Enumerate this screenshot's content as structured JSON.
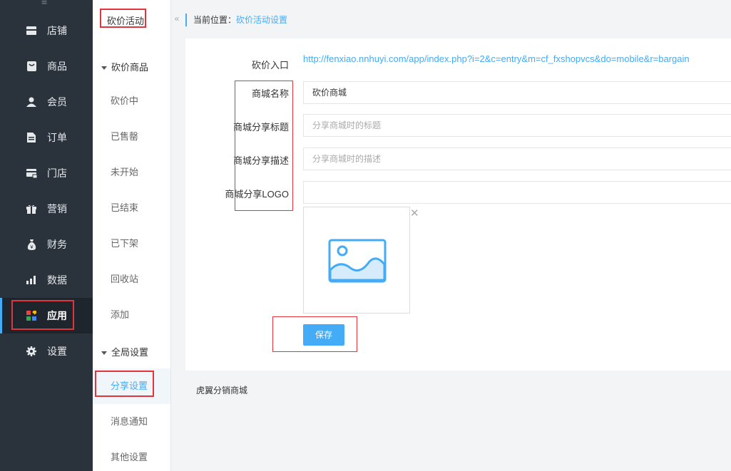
{
  "nav": {
    "items": [
      {
        "label": "店铺",
        "icon": "store-icon"
      },
      {
        "label": "商品",
        "icon": "goods-icon"
      },
      {
        "label": "会员",
        "icon": "member-icon"
      },
      {
        "label": "订单",
        "icon": "order-icon"
      },
      {
        "label": "门店",
        "icon": "shop-icon"
      },
      {
        "label": "营销",
        "icon": "gift-icon"
      },
      {
        "label": "财务",
        "icon": "money-bag-icon"
      },
      {
        "label": "数据",
        "icon": "bar-chart-icon"
      },
      {
        "label": "应用",
        "icon": "apps-icon"
      },
      {
        "label": "设置",
        "icon": "gear-icon"
      }
    ],
    "active": "应用"
  },
  "submenu": {
    "title": "砍价活动",
    "groups": [
      {
        "label": "砍价商品",
        "items": [
          "砍价中",
          "已售罄",
          "未开始",
          "已结束",
          "已下架",
          "回收站",
          "添加"
        ]
      },
      {
        "label": "全局设置",
        "items": [
          "分享设置",
          "消息通知",
          "其他设置"
        ]
      }
    ],
    "active": "分享设置"
  },
  "breadcrumb": {
    "prefix": "当前位置：",
    "current": "砍价活动设置"
  },
  "form": {
    "entry_label": "砍价入口",
    "entry_url": "http://fenxiao.nnhuyi.com/app/index.php?i=2&c=entry&m=cf_fxshopvcs&do=mobile&r=bargain",
    "shop_name_label": "商城名称",
    "shop_name_value": "砍价商城",
    "share_title_label": "商城分享标题",
    "share_title_placeholder": "分享商城时的标题",
    "share_desc_label": "商城分享描述",
    "share_desc_placeholder": "分享商城时的描述",
    "share_logo_label": "商城分享LOGO",
    "share_logo_value": "",
    "save_label": "保存"
  },
  "footer": "虎翼分销商城",
  "colors": {
    "accent": "#44abf7",
    "sidebar": "#2a323c",
    "annotation": "#e0353a"
  }
}
